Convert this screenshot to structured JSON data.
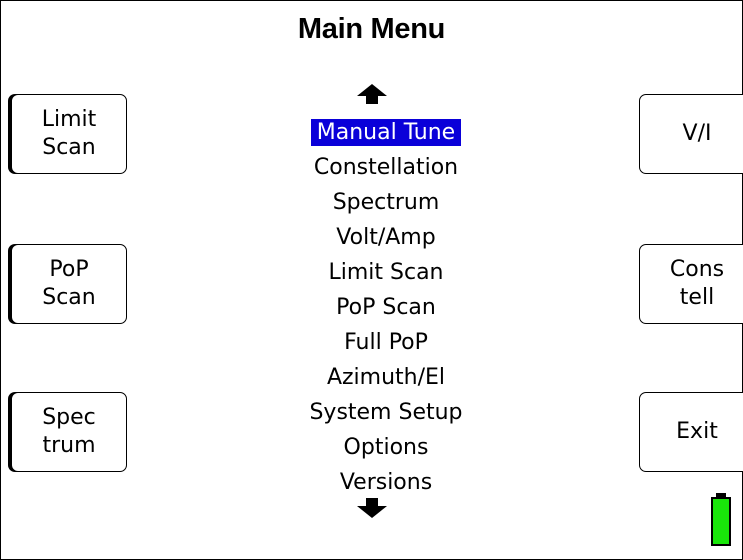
{
  "title": "Main Menu",
  "left_keys": [
    {
      "line1": "Limit",
      "line2": "Scan"
    },
    {
      "line1": "PoP",
      "line2": "Scan"
    },
    {
      "line1": "Spec",
      "line2": "trum"
    }
  ],
  "right_keys": [
    {
      "line1": "V/I",
      "line2": ""
    },
    {
      "line1": "Cons",
      "line2": "tell"
    },
    {
      "line1": "Exit",
      "line2": ""
    }
  ],
  "menu": {
    "selected_index": 0,
    "items": [
      "Manual Tune",
      "Constellation",
      "Spectrum",
      "Volt/Amp",
      "Limit Scan",
      "PoP Scan",
      "Full PoP",
      "Azimuth/El",
      "System Setup",
      "Options",
      "Versions"
    ]
  },
  "icons": {
    "scroll_up": "arrow-up-icon",
    "scroll_down": "arrow-down-icon",
    "battery": "battery-icon"
  },
  "colors": {
    "selection": "#0a00d9",
    "battery": "#19e60a"
  },
  "battery_level": 1.0
}
